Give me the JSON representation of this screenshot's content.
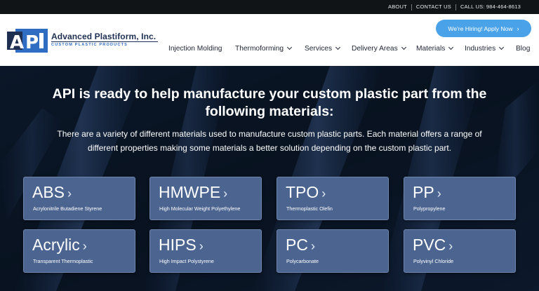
{
  "topbar": {
    "about": "ABOUT",
    "contact": "CONTACT US",
    "call": "CALL US: 984-464-8613"
  },
  "brand": {
    "logo_text": "API",
    "name": "Advanced Plastiform, Inc.",
    "tagline": "CUSTOM PLASTIC PRODUCTS",
    "colors": {
      "navy": "#1f2f52",
      "blue": "#2f6dc2"
    }
  },
  "cta": {
    "label": "We're Hiring! Apply Now",
    "icon": "chevron-right-icon",
    "color": "#4aa3e8"
  },
  "nav": [
    {
      "label": "Injection Molding",
      "dropdown": false
    },
    {
      "label": "Thermoforming",
      "dropdown": true
    },
    {
      "label": "Services",
      "dropdown": true
    },
    {
      "label": "Delivery Areas",
      "dropdown": true
    },
    {
      "label": "Materials",
      "dropdown": true
    },
    {
      "label": "Industries",
      "dropdown": true
    },
    {
      "label": "Blog",
      "dropdown": false
    }
  ],
  "hero": {
    "headline_1": "API is ready to help manufacture your custom plastic part from the",
    "headline_2": "following materials:",
    "sub_1": "There are a variety of different materials used to manufacture custom plastic parts. Each material offers a range of",
    "sub_2": "different properties making some materials a better solution depending on the custom plastic part."
  },
  "materials": [
    {
      "abbr": "ABS",
      "full": "Acrylonitrile Butadiene Styrene"
    },
    {
      "abbr": "HMWPE",
      "full": "High Molecular Weight Polyethylene"
    },
    {
      "abbr": "TPO",
      "full": "Thermoplastic Olefin"
    },
    {
      "abbr": "PP",
      "full": "Polypropylene"
    },
    {
      "abbr": "Acrylic",
      "full": "Transparent Thermoplastic"
    },
    {
      "abbr": "HIPS",
      "full": "High Impact Polystyrene"
    },
    {
      "abbr": "PC",
      "full": "Polycarbonate"
    },
    {
      "abbr": "PVC",
      "full": "Polyvinyl Chloride"
    }
  ],
  "card_arrow": "›"
}
